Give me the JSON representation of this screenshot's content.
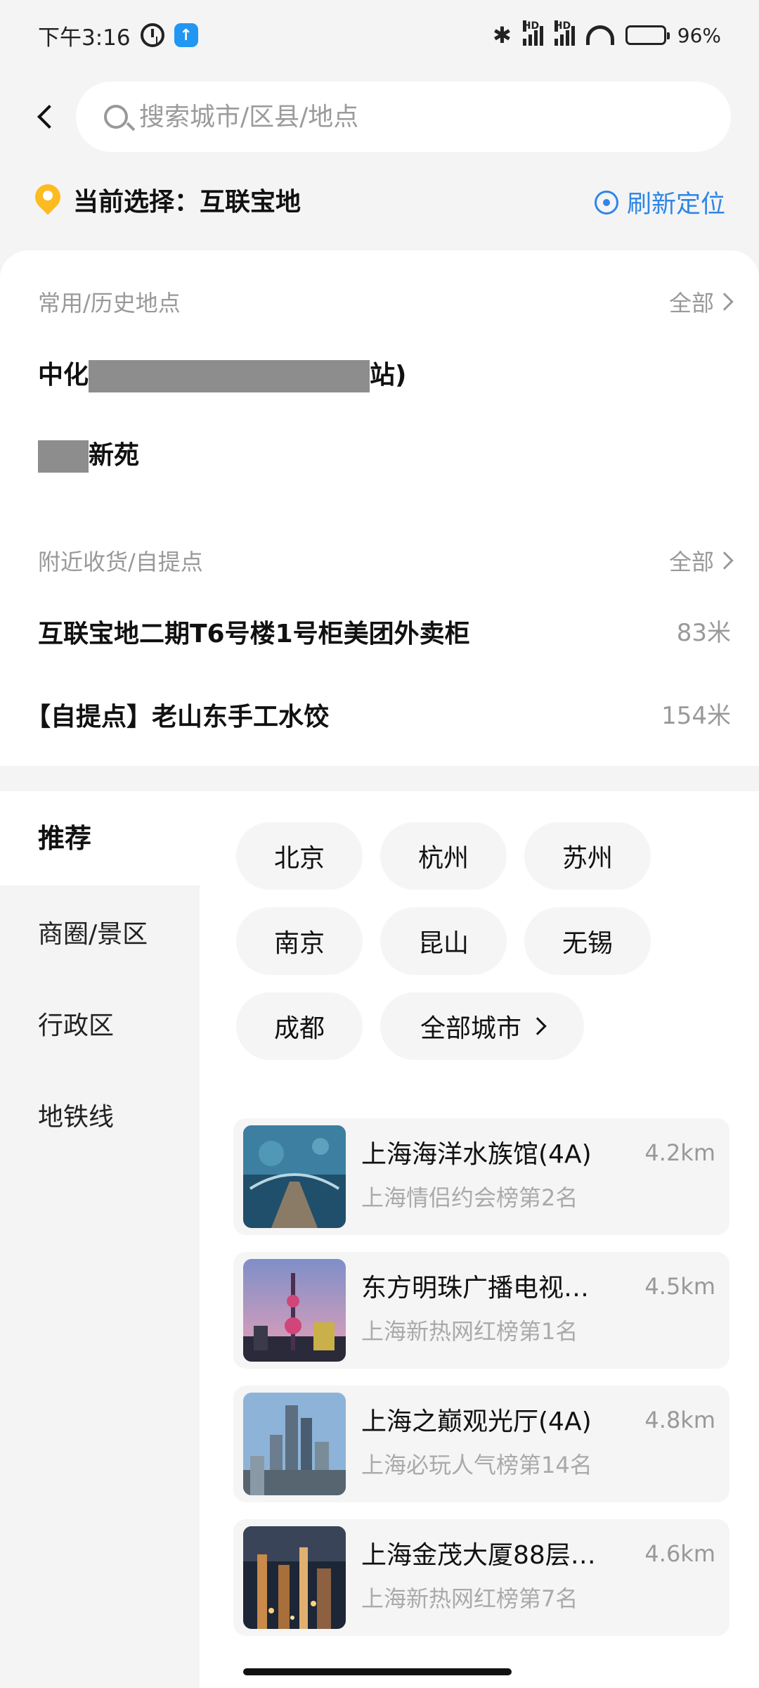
{
  "status_bar": {
    "time": "下午3:16",
    "network_labels": [
      "HD",
      "HD"
    ],
    "battery": "96"
  },
  "search": {
    "placeholder": "搜索城市/区县/地点"
  },
  "current": {
    "label": "当前选择：互联宝地",
    "refresh_label": "刷新定位"
  },
  "common_places": {
    "title": "常用/历史地点",
    "all_label": "全部",
    "items": [
      {
        "prefix": "中化",
        "suffix": "站)"
      },
      {
        "prefix": "",
        "suffix": "新苑"
      }
    ]
  },
  "nearby": {
    "title": "附近收货/自提点",
    "all_label": "全部",
    "items": [
      {
        "name": "互联宝地二期T6号楼1号柜美团外卖柜",
        "distance": "83米"
      },
      {
        "name": "【自提点】老山东手工水饺",
        "distance": "154米"
      }
    ]
  },
  "left_nav": {
    "recommend": "推荐",
    "items": [
      "商圈/景区",
      "行政区",
      "地铁线"
    ]
  },
  "cities": [
    "北京",
    "杭州",
    "苏州",
    "南京",
    "昆山",
    "无锡",
    "成都"
  ],
  "all_cities_label": "全部城市",
  "attractions": [
    {
      "title": "上海海洋水族馆(4A)",
      "sub": "上海情侣约会榜第2名",
      "distance": "4.2km",
      "thumb": "aquarium-image"
    },
    {
      "title": "东方明珠广播电视…",
      "sub": "上海新热网红榜第1名",
      "distance": "4.5km",
      "thumb": "tower-image"
    },
    {
      "title": "上海之巅观光厅(4A)",
      "sub": "上海必玩人气榜第14名",
      "distance": "4.8km",
      "thumb": "skyline-image"
    },
    {
      "title": "上海金茂大厦88层…",
      "sub": "上海新热网红榜第7名",
      "distance": "4.6km",
      "thumb": "night-city-image"
    }
  ],
  "colors": {
    "accent_blue": "#2f86e6",
    "pin_yellow": "#fcbb21",
    "muted_text": "#999999",
    "background": "#f4f4f4"
  }
}
